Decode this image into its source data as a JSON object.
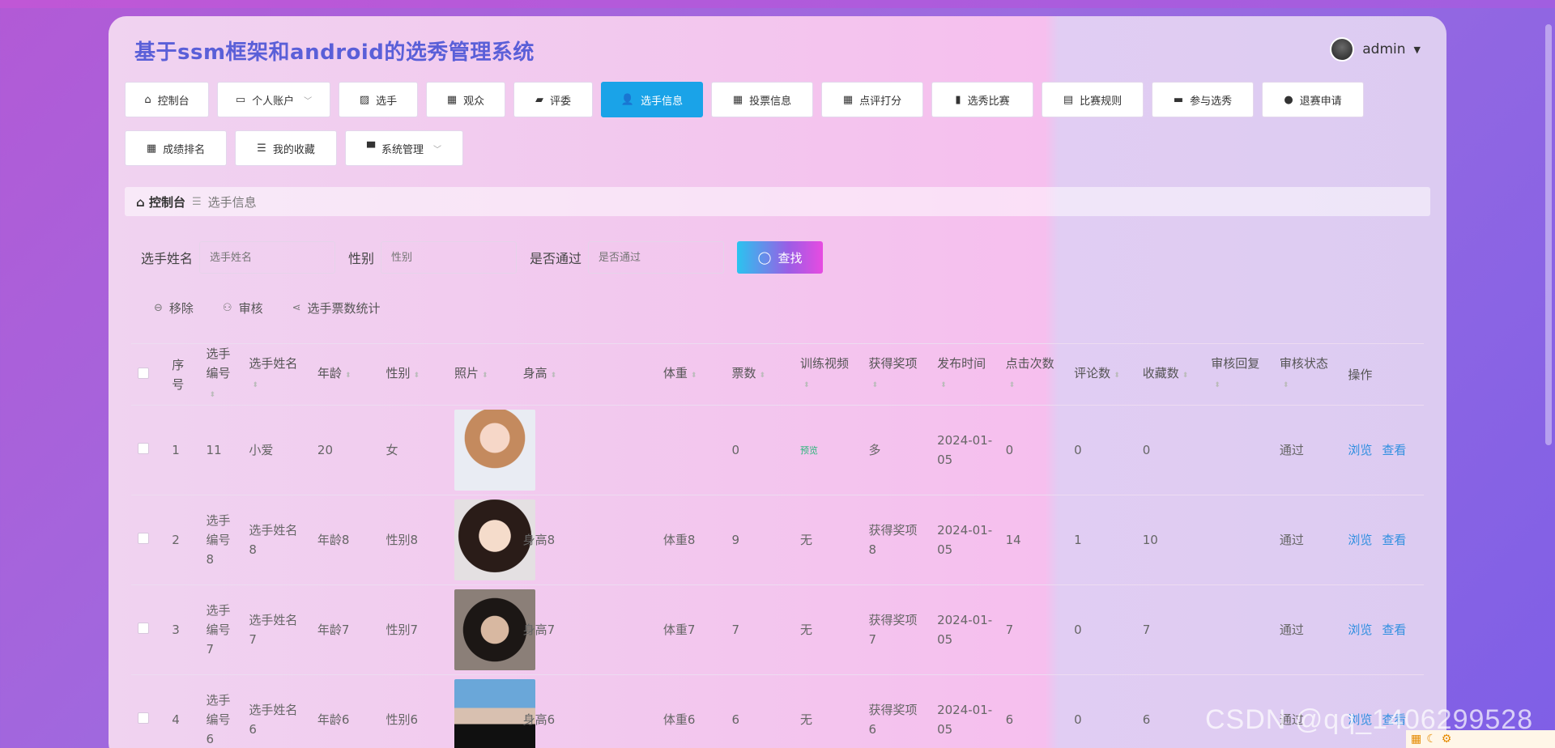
{
  "app": {
    "title": "基于ssm框架和android的选秀管理系统",
    "user": "admin"
  },
  "nav": {
    "row1": [
      {
        "label": "控制台",
        "icon": "home-icon",
        "glyph": "⌂",
        "dropdown": false,
        "active": false,
        "w": 104
      },
      {
        "label": "个人账户",
        "icon": "account-icon",
        "glyph": "▭",
        "dropdown": true,
        "active": false,
        "w": 140
      },
      {
        "label": "选手",
        "icon": "chart-icon",
        "glyph": "▨",
        "dropdown": false,
        "active": false,
        "w": 98
      },
      {
        "label": "观众",
        "icon": "grid-icon",
        "glyph": "▦",
        "dropdown": false,
        "active": false,
        "w": 98
      },
      {
        "label": "评委",
        "icon": "wallet-icon",
        "glyph": "▰",
        "dropdown": false,
        "active": false,
        "w": 98
      },
      {
        "label": "选手信息",
        "icon": "user-icon",
        "glyph": "👤",
        "dropdown": false,
        "active": true,
        "w": 126
      },
      {
        "label": "投票信息",
        "icon": "grid-icon",
        "glyph": "▦",
        "dropdown": false,
        "active": false,
        "w": 126
      },
      {
        "label": "点评打分",
        "icon": "grid-icon",
        "glyph": "▦",
        "dropdown": false,
        "active": false,
        "w": 126
      },
      {
        "label": "选秀比赛",
        "icon": "bar-chart-icon",
        "glyph": "▮",
        "dropdown": false,
        "active": false,
        "w": 126
      },
      {
        "label": "比赛规则",
        "icon": "briefcase-icon",
        "glyph": "▤",
        "dropdown": false,
        "active": false,
        "w": 126
      },
      {
        "label": "参与选秀",
        "icon": "inbox-icon",
        "glyph": "▬",
        "dropdown": false,
        "active": false,
        "w": 126
      },
      {
        "label": "退赛申请",
        "icon": "pin-icon",
        "glyph": "●",
        "dropdown": false,
        "active": false,
        "w": 126
      }
    ],
    "row2": [
      {
        "label": "成绩排名",
        "icon": "grid-icon",
        "glyph": "▦",
        "dropdown": false,
        "active": false,
        "w": 126
      },
      {
        "label": "我的收藏",
        "icon": "sliders-icon",
        "glyph": "☰",
        "dropdown": false,
        "active": false,
        "w": 126
      },
      {
        "label": "系统管理",
        "icon": "brush-icon",
        "glyph": "▀",
        "dropdown": true,
        "active": false,
        "w": 146
      }
    ]
  },
  "breadcrumb": {
    "home": "控制台",
    "current": "选手信息"
  },
  "search": {
    "name_label": "选手姓名",
    "name_placeholder": "选手姓名",
    "gender_label": "性别",
    "gender_placeholder": "性别",
    "pass_label": "是否通过",
    "pass_placeholder": "是否通过",
    "button": "查找"
  },
  "actions": {
    "remove": "移除",
    "review": "审核",
    "stats": "选手票数统计"
  },
  "table": {
    "headers": [
      "序号",
      "选手编号",
      "选手姓名",
      "年龄",
      "性别",
      "照片",
      "身高",
      "体重",
      "票数",
      "训练视频",
      "获得奖项",
      "发布时间",
      "点击次数",
      "评论数",
      "收藏数",
      "审核回复",
      "审核状态",
      "操作"
    ],
    "rows": [
      {
        "idx": "1",
        "code": "11",
        "name": "小爱",
        "age": "20",
        "gender": "女",
        "photo": "p1",
        "height": "",
        "weight": "",
        "votes": "0",
        "video": "预览",
        "award": "多",
        "time": "2024-01-05",
        "clicks": "0",
        "comments": "0",
        "favs": "0",
        "reply": "",
        "status": "通过"
      },
      {
        "idx": "2",
        "code": "选手编号8",
        "name": "选手姓名8",
        "age": "年龄8",
        "gender": "性别8",
        "photo": "p2",
        "height": "身高8",
        "weight": "体重8",
        "votes": "9",
        "video": "无",
        "award": "获得奖项8",
        "time": "2024-01-05",
        "clicks": "14",
        "comments": "1",
        "favs": "10",
        "reply": "",
        "status": "通过"
      },
      {
        "idx": "3",
        "code": "选手编号7",
        "name": "选手姓名7",
        "age": "年龄7",
        "gender": "性别7",
        "photo": "p3",
        "height": "身高7",
        "weight": "体重7",
        "votes": "7",
        "video": "无",
        "award": "获得奖项7",
        "time": "2024-01-05",
        "clicks": "7",
        "comments": "0",
        "favs": "7",
        "reply": "",
        "status": "通过"
      },
      {
        "idx": "4",
        "code": "选手编号6",
        "name": "选手姓名6",
        "age": "年龄6",
        "gender": "性别6",
        "photo": "p4",
        "height": "身高6",
        "weight": "体重6",
        "votes": "6",
        "video": "无",
        "award": "获得奖项6",
        "time": "2024-01-05",
        "clicks": "6",
        "comments": "0",
        "favs": "6",
        "reply": "",
        "status": "通过"
      }
    ],
    "ops": {
      "browse": "浏览",
      "view": "查看"
    }
  },
  "watermark": "CSDN @qq_1406299528"
}
